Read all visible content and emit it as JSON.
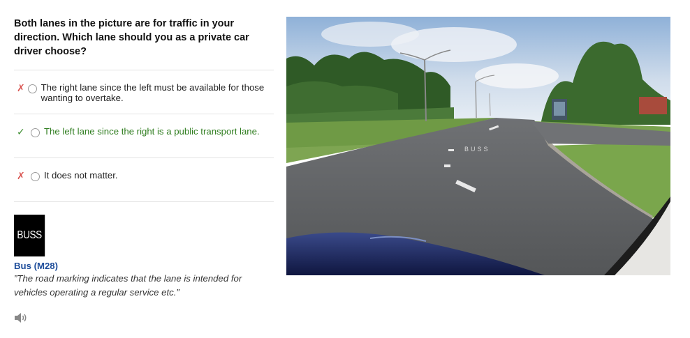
{
  "question": "Both lanes in the picture are for traffic in your direction. Which lane should you as a private car driver choose?",
  "options": [
    {
      "status": "wrong",
      "mark": "✗",
      "text": "The right lane since the left must be available for those wanting to overtake."
    },
    {
      "status": "correct",
      "mark": "✓",
      "text": "The left lane since the right is a public transport lane."
    },
    {
      "status": "wrong",
      "mark": "✗",
      "text": "It does not matter."
    }
  ],
  "sign": {
    "image_text": "BUSS",
    "title": "Bus (M28)",
    "description": "”The road marking indicates that the lane is intended for vehicles operating a regular service etc.”"
  },
  "photo": {
    "road_marking": "BUSS"
  },
  "icons": {
    "speaker": "speaker-icon"
  },
  "colors": {
    "wrong": "#d9534f",
    "correct": "#2f7d1f",
    "sign_title": "#1f4e9b"
  }
}
